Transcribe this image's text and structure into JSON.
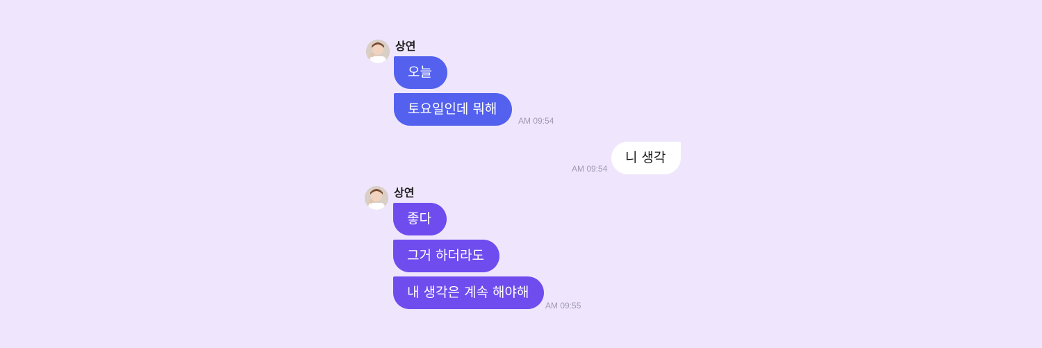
{
  "conversation": [
    {
      "sender": "상연",
      "avatar_icon": "avatar-icon",
      "messages": [
        "오늘",
        "토요일인데 뭐해"
      ],
      "time": "AM 09:54"
    },
    {
      "outgoing": true,
      "messages": [
        "니 생각"
      ],
      "time": "AM 09:54"
    },
    {
      "sender": "상연",
      "avatar_icon": "avatar-icon",
      "messages": [
        "좋다",
        "그거 하더라도",
        "내 생각은 계속 해야해"
      ],
      "time": "AM 09:55"
    }
  ],
  "colors": {
    "background": "#efe6fd",
    "incoming_blue": "#5361ee",
    "incoming_purple": "#6f4cee",
    "outgoing": "#ffffff",
    "timestamp": "#a09ab2"
  }
}
